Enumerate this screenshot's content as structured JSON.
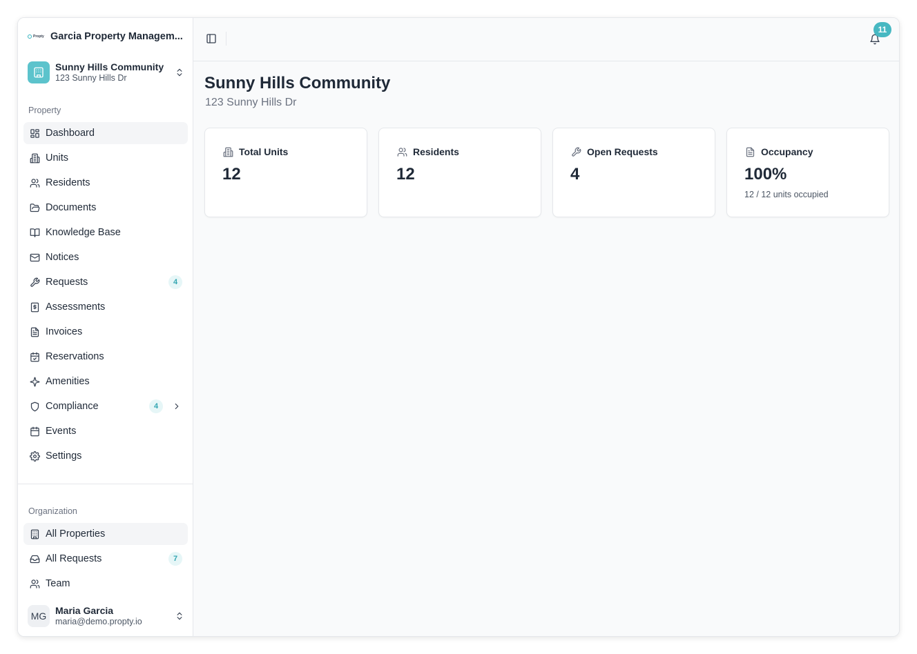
{
  "brand": {
    "logo_word": "Propty",
    "name": "Garcia Property Managem..."
  },
  "property_switcher": {
    "name": "Sunny Hills Community",
    "address": "123 Sunny Hills Dr"
  },
  "sidebar": {
    "property_section_label": "Property",
    "property_items": [
      {
        "label": "Dashboard",
        "icon": "dashboard-icon",
        "active": true
      },
      {
        "label": "Units",
        "icon": "building-icon"
      },
      {
        "label": "Residents",
        "icon": "users-icon"
      },
      {
        "label": "Documents",
        "icon": "folder-icon"
      },
      {
        "label": "Knowledge Base",
        "icon": "book-icon"
      },
      {
        "label": "Notices",
        "icon": "mail-icon"
      },
      {
        "label": "Requests",
        "icon": "wrench-icon",
        "badge": "4"
      },
      {
        "label": "Assessments",
        "icon": "dollar-receipt-icon"
      },
      {
        "label": "Invoices",
        "icon": "file-text-icon"
      },
      {
        "label": "Reservations",
        "icon": "calendar-check-icon"
      },
      {
        "label": "Amenities",
        "icon": "sparkles-icon"
      },
      {
        "label": "Compliance",
        "icon": "shield-icon",
        "badge": "4"
      },
      {
        "label": "Events",
        "icon": "calendar-icon"
      },
      {
        "label": "Settings",
        "icon": "gear-icon"
      }
    ],
    "organization_section_label": "Organization",
    "organization_items": [
      {
        "label": "All Properties",
        "icon": "building-office-icon",
        "active": true
      },
      {
        "label": "All Requests",
        "icon": "inbox-icon",
        "badge": "7"
      },
      {
        "label": "Team",
        "icon": "users-icon"
      }
    ]
  },
  "user": {
    "initials": "MG",
    "name": "Maria Garcia",
    "email": "maria@demo.propty.io"
  },
  "topbar": {
    "notification_count": "11"
  },
  "page": {
    "title": "Sunny Hills Community",
    "subtitle": "123 Sunny Hills Dr"
  },
  "stats": [
    {
      "label": "Total Units",
      "value": "12",
      "icon": "building-icon"
    },
    {
      "label": "Residents",
      "value": "12",
      "icon": "users-icon"
    },
    {
      "label": "Open Requests",
      "value": "4",
      "icon": "wrench-icon"
    },
    {
      "label": "Occupancy",
      "value": "100%",
      "note": "12 / 12 units occupied",
      "icon": "file-text-icon"
    }
  ],
  "colors": {
    "accent": "#47b8c2",
    "badge_bg": "#e6f6f7",
    "badge_text": "#34a6b2"
  }
}
